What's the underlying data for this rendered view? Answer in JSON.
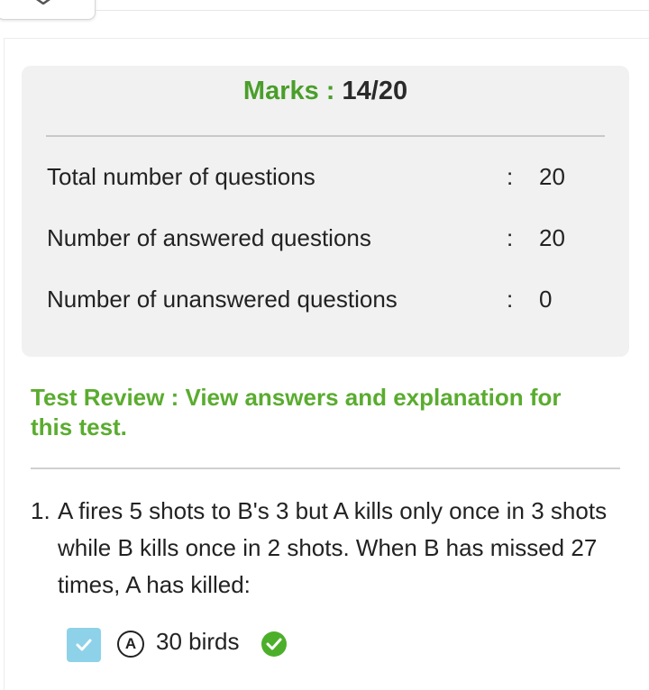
{
  "summary": {
    "marks_label": "Marks :",
    "marks_value": "14/20",
    "rows": [
      {
        "label": "Total number of questions",
        "colon": ":",
        "value": "20"
      },
      {
        "label": "Number of answered questions",
        "colon": ":",
        "value": "20"
      },
      {
        "label": "Number of unanswered questions",
        "colon": ":",
        "value": "0"
      }
    ]
  },
  "review": {
    "text": "Test Review : View answers and explanation for this test."
  },
  "question": {
    "number": "1.",
    "text": "A fires 5 shots to B's 3 but A kills only once in 3 shots while B kills once in 2 shots. When B has missed 27 times, A has killed:",
    "options": [
      {
        "letter": "A",
        "text": "30 birds",
        "checked": true,
        "correct": true
      }
    ]
  },
  "colors": {
    "accent_green": "#4a9e2a",
    "review_green": "#5aac2f",
    "checkbox_blue": "#8dd2e8",
    "correct_green": "#4caf2a"
  },
  "icons": [
    "chevron-up-icon",
    "checkmark-icon",
    "correct-check-icon"
  ]
}
